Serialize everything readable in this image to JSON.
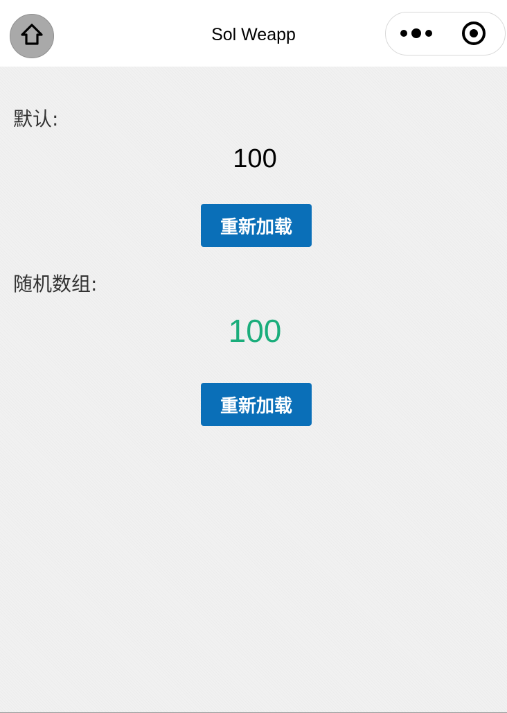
{
  "navbar": {
    "title": "Sol Weapp",
    "home_icon": "home-icon",
    "more_icon": "more-dots-icon",
    "close_icon": "target-circle-icon"
  },
  "sections": [
    {
      "label": "默认:",
      "value": "100",
      "value_color": "#000000",
      "button_label": "重新加载"
    },
    {
      "label": "随机数组:",
      "value": "100",
      "value_color": "#1aad7b",
      "button_label": "重新加载"
    }
  ],
  "colors": {
    "button_bg": "#0a6fb8",
    "accent_green": "#1aad7b"
  }
}
